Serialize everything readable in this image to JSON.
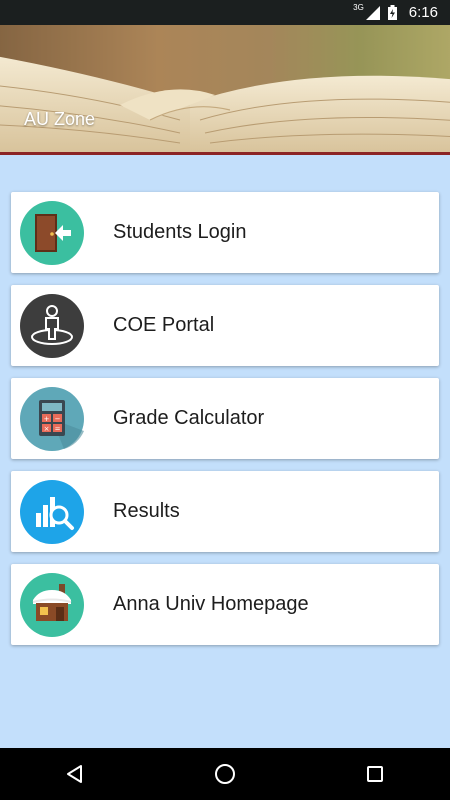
{
  "status_bar": {
    "network": "3G",
    "time": "6:16"
  },
  "header": {
    "title": "AU Zone"
  },
  "menu": {
    "items": [
      {
        "label": "Students Login",
        "icon": "login-door-icon",
        "icon_color": "#3bbfa0"
      },
      {
        "label": "COE Portal",
        "icon": "person-pin-icon",
        "icon_color": "#3d3d3d"
      },
      {
        "label": "Grade Calculator",
        "icon": "calculator-icon",
        "icon_color": "#5fa8b8"
      },
      {
        "label": "Results",
        "icon": "results-chart-search-icon",
        "icon_color": "#1ea4e8"
      },
      {
        "label": "Anna Univ Homepage",
        "icon": "house-icon",
        "icon_color": "#3bbfa0"
      }
    ]
  },
  "colors": {
    "background": "#c3dffb",
    "status_bar": "#1b1f1f",
    "nav_bar": "#000000"
  }
}
